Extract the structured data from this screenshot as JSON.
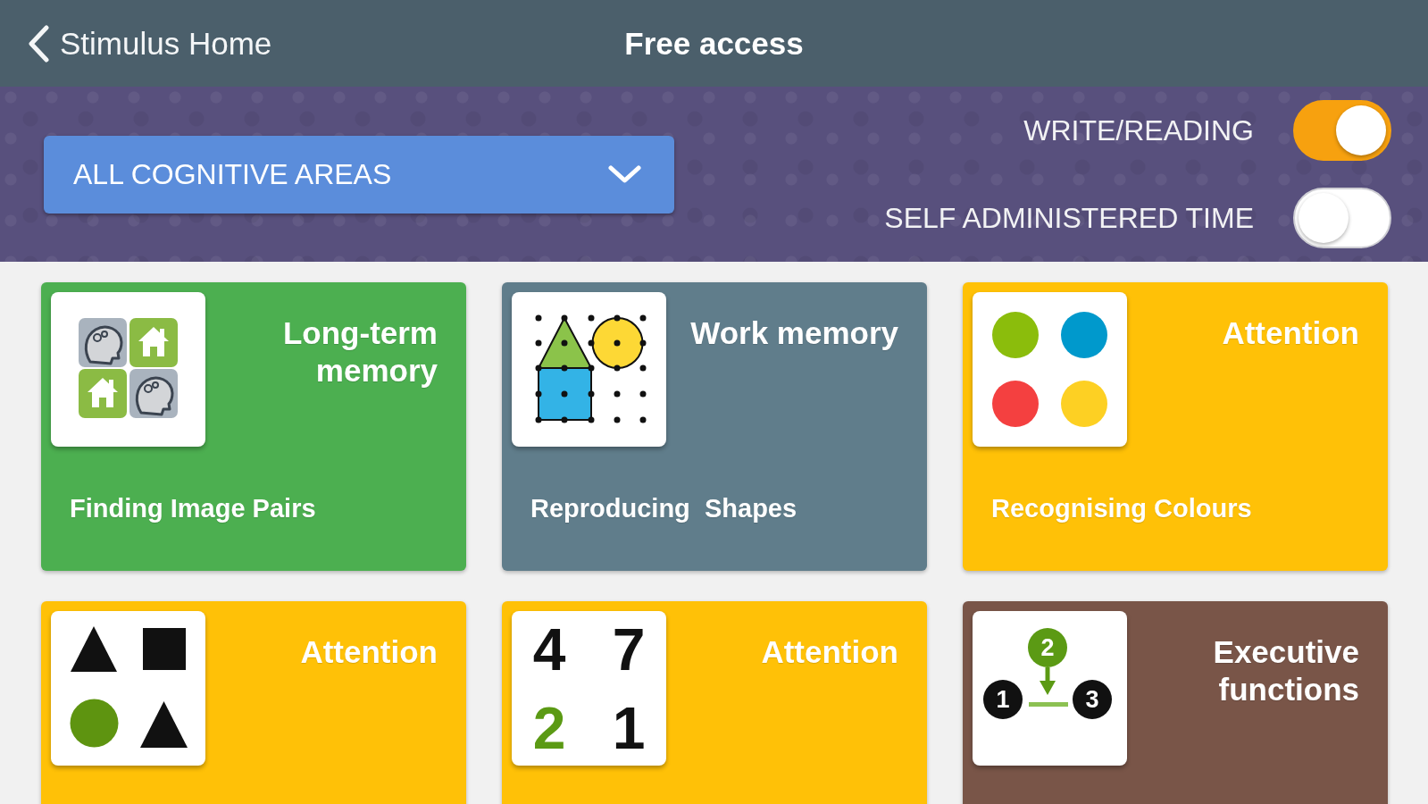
{
  "header": {
    "back_label": "Stimulus Home",
    "title": "Free access"
  },
  "filter": {
    "dropdown": {
      "value": "ALL COGNITIVE AREAS"
    },
    "toggles": [
      {
        "label": "WRITE/READING",
        "on": true
      },
      {
        "label": "SELF ADMINISTERED TIME",
        "on": false
      }
    ]
  },
  "cards": [
    {
      "category": "Long-term memory",
      "title": "Finding Image Pairs",
      "color": "#4caf50",
      "thumbnail": {
        "kind": "pairs"
      }
    },
    {
      "category": "Work memory",
      "title": "Reproducing  Shapes",
      "color": "#607d8b",
      "thumbnail": {
        "kind": "shapes"
      }
    },
    {
      "category": "Attention",
      "title": "Recognising Colours",
      "color": "#ffc107",
      "thumbnail": {
        "kind": "dots",
        "dots": [
          {
            "color": "#8bbd0c"
          },
          {
            "color": "#0099cc"
          },
          {
            "color": "#f44040"
          },
          {
            "color": "#fdd023"
          }
        ]
      }
    },
    {
      "category": "Attention",
      "color": "#ffc107",
      "thumbnail": {
        "kind": "symbols"
      }
    },
    {
      "category": "Attention",
      "color": "#ffc107",
      "thumbnail": {
        "kind": "digits",
        "digits": [
          {
            "text": "4",
            "color": "#111111"
          },
          {
            "text": "7",
            "color": "#111111"
          },
          {
            "text": "2",
            "color": "#5b9a14"
          },
          {
            "text": "1",
            "color": "#111111"
          }
        ]
      }
    },
    {
      "category": "Executive functions",
      "color": "#795548",
      "thumbnail": {
        "kind": "sequence",
        "nodes": [
          {
            "text": "1",
            "color": "#111111"
          },
          {
            "text": "2",
            "color": "#5b9a14"
          },
          {
            "text": "3",
            "color": "#111111"
          }
        ]
      }
    }
  ]
}
